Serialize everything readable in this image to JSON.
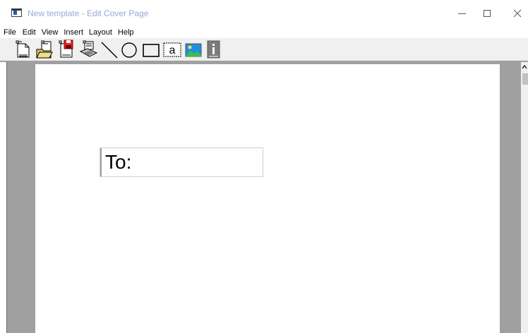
{
  "window": {
    "title": "New template - Edit Cover Page",
    "icon": "app-window-icon"
  },
  "window_controls": [
    "minimize-icon",
    "maximize-icon",
    "close-icon"
  ],
  "menu": {
    "file": "File",
    "edit": "Edit",
    "view": "View",
    "insert": "Insert",
    "layout": "Layout",
    "help": "Help"
  },
  "toolbar": {
    "tools": [
      "new-page-icon",
      "open-page-icon",
      "save-page-icon",
      "fax-page-icon",
      "line-tool-icon",
      "ellipse-tool-icon",
      "rectangle-tool-icon",
      "text-tool-icon",
      "picture-tool-icon",
      "info-field-icon"
    ],
    "text_tool_glyph": "a"
  },
  "canvas": {
    "to_field_label": "To:"
  },
  "colors": {
    "workspace": "#a0a0a0",
    "toolbar": "#f0f0f0",
    "page": "#ffffff",
    "save_red": "#e3262a",
    "picture_blue": "#1e8fe0",
    "picture_green": "#3fbf3f"
  }
}
